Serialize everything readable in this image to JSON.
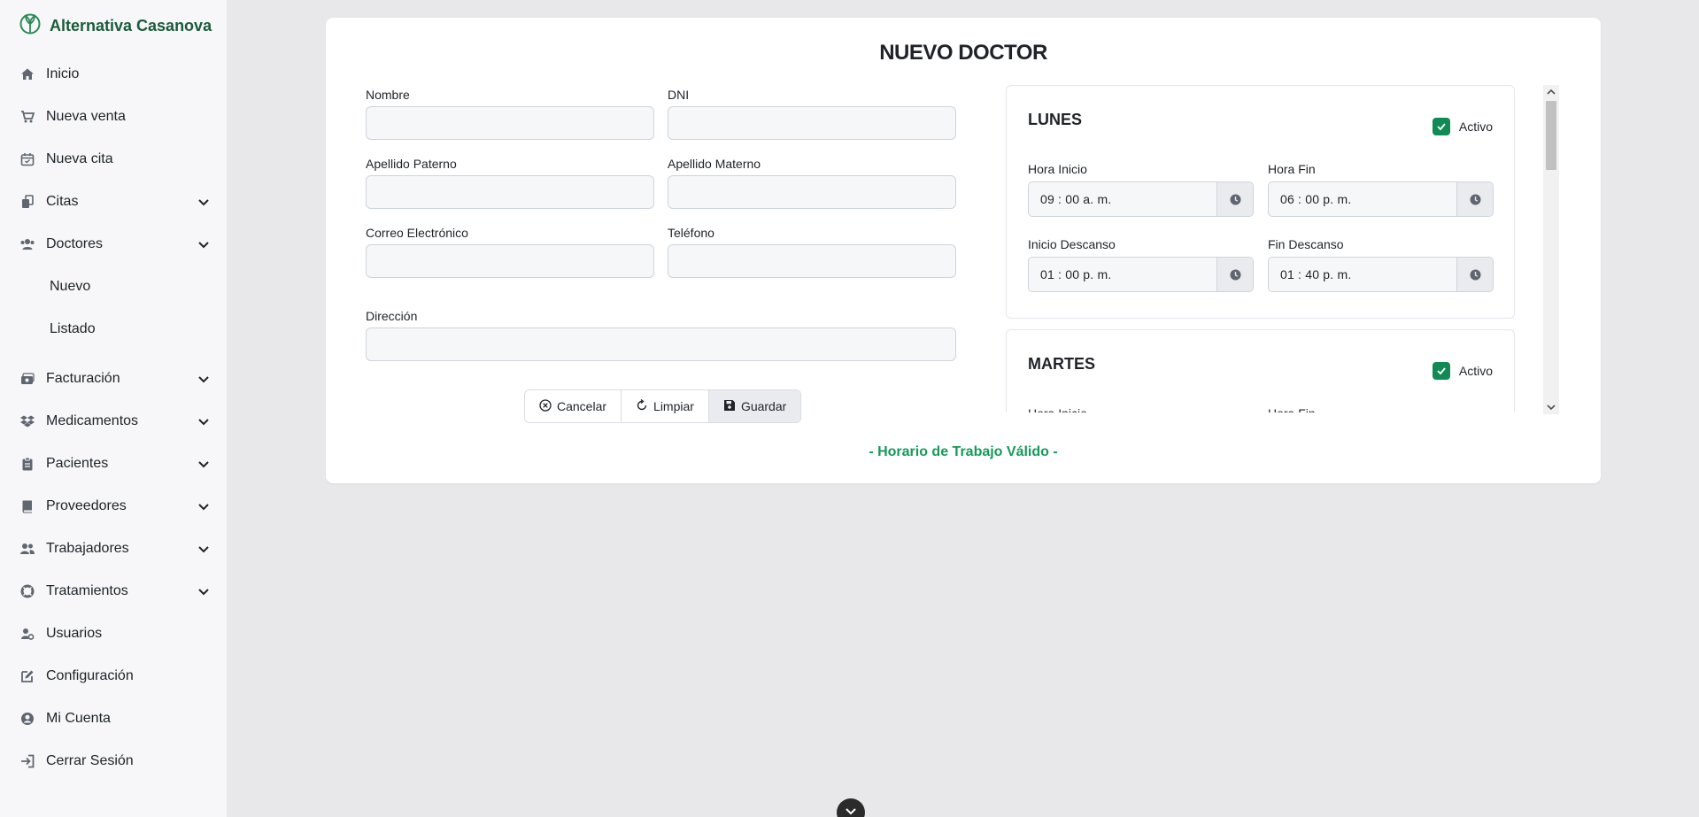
{
  "brand": {
    "name": "Alternativa Casanova",
    "color": "#1a5c38"
  },
  "sidebar": {
    "items": [
      {
        "label": "Inicio",
        "icon": "home-icon"
      },
      {
        "label": "Nueva venta",
        "icon": "cart-icon"
      },
      {
        "label": "Nueva cita",
        "icon": "calendar-icon"
      },
      {
        "label": "Citas",
        "icon": "copy-icon",
        "expandable": true
      },
      {
        "label": "Doctores",
        "icon": "users-icon",
        "expandable": true,
        "expanded": true,
        "children": [
          {
            "label": "Nuevo"
          },
          {
            "label": "Listado"
          }
        ]
      },
      {
        "label": "Facturación",
        "icon": "cash-register-icon",
        "expandable": true
      },
      {
        "label": "Medicamentos",
        "icon": "dropbox-icon",
        "expandable": true
      },
      {
        "label": "Pacientes",
        "icon": "clipboard-icon",
        "expandable": true
      },
      {
        "label": "Proveedores",
        "icon": "book-icon",
        "expandable": true
      },
      {
        "label": "Trabajadores",
        "icon": "user-group-icon",
        "expandable": true
      },
      {
        "label": "Tratamientos",
        "icon": "lifebuoy-icon",
        "expandable": true
      },
      {
        "label": "Usuarios",
        "icon": "user-gear-icon"
      },
      {
        "label": "Configuración",
        "icon": "edit-icon"
      },
      {
        "label": "Mi Cuenta",
        "icon": "user-circle-icon"
      },
      {
        "label": "Cerrar Sesión",
        "icon": "sign-out-icon"
      }
    ]
  },
  "form": {
    "title": "NUEVO DOCTOR",
    "fields": {
      "nombre": {
        "label": "Nombre",
        "value": ""
      },
      "dni": {
        "label": "DNI",
        "value": ""
      },
      "apellido_paterno": {
        "label": "Apellido Paterno",
        "value": ""
      },
      "apellido_materno": {
        "label": "Apellido Materno",
        "value": ""
      },
      "correo": {
        "label": "Correo Electrónico",
        "value": ""
      },
      "telefono": {
        "label": "Teléfono",
        "value": ""
      },
      "direccion": {
        "label": "Dirección",
        "value": ""
      }
    },
    "buttons": {
      "cancel": "Cancelar",
      "clear": "Limpiar",
      "save": "Guardar"
    },
    "valid_message": "- Horario de Trabajo Válido -"
  },
  "schedule": {
    "labels": {
      "active": "Activo",
      "hora_inicio": "Hora Inicio",
      "hora_fin": "Hora Fin",
      "inicio_descanso": "Inicio Descanso",
      "fin_descanso": "Fin Descanso"
    },
    "days": [
      {
        "name": "LUNES",
        "active": true,
        "hora_inicio": "09 : 00   a. m.",
        "hora_fin": "06 : 00   p. m.",
        "inicio_descanso": "01 : 00   p. m.",
        "fin_descanso": "01 : 40   p. m."
      },
      {
        "name": "MARTES",
        "active": true
      }
    ]
  },
  "colors": {
    "accent_green": "#128a55",
    "valid_text": "#159a5a"
  }
}
